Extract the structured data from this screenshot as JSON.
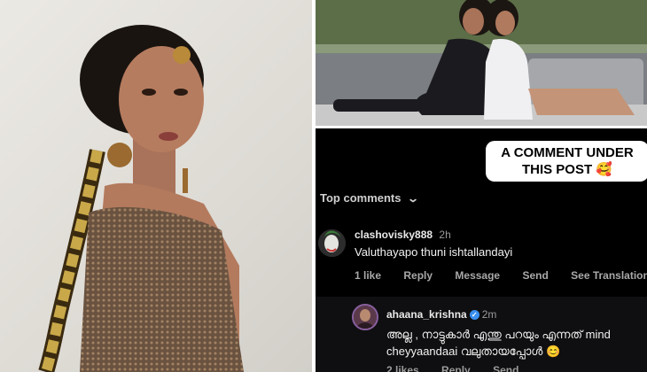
{
  "callout": {
    "line1": "A COMMENT UNDER",
    "line2": "THIS POST",
    "emoji": "🥰"
  },
  "comments_header": {
    "label": "Top comments",
    "chevron": "⌄"
  },
  "comment1": {
    "username": "clashovisky888",
    "time": "2h",
    "text": "Valuthayapo thuni ishtallandayi",
    "actions": [
      "1 like",
      "Reply",
      "Message",
      "Send",
      "See Translation"
    ]
  },
  "comment2": {
    "username": "ahaana_krishna",
    "time": "2m",
    "verified_icon": "verified-badge-icon",
    "text": "അല്ല , നാട്ടുകാർ എന്തു പറയും എന്നത് mind cheyyaandaai വലുതായപ്പോൾ",
    "emoji": "😊",
    "actions": [
      "2 likes",
      "Reply",
      "Send"
    ]
  },
  "colors": {
    "accent_verified": "#3a8ff0",
    "panel_bg": "#000000"
  }
}
